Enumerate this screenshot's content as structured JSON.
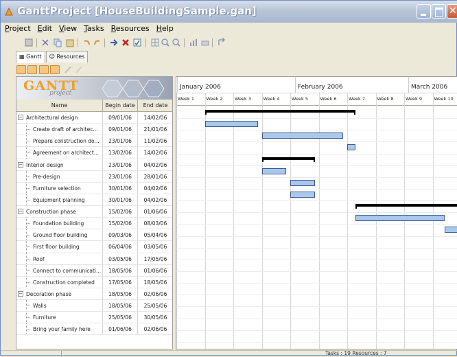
{
  "window": {
    "title": "GanttProject [HouseBuildingSample.gan]"
  },
  "menu": [
    "Project",
    "Edit",
    "View",
    "Tasks",
    "Resources",
    "Help"
  ],
  "tabs": [
    {
      "label": "Gantt",
      "active": true
    },
    {
      "label": "Resources",
      "active": false
    }
  ],
  "logo": {
    "word": "GANTT",
    "sub": "project"
  },
  "tree": {
    "columns": [
      "Name",
      "Begin date",
      "End date"
    ],
    "rows": [
      {
        "name": "Architectural design",
        "begin": "09/01/06",
        "end": "14/02/06",
        "group": true
      },
      {
        "name": "Create draft of architec...",
        "begin": "09/01/06",
        "end": "21/01/06"
      },
      {
        "name": "Prepare construction do...",
        "begin": "23/01/06",
        "end": "11/02/06"
      },
      {
        "name": "Agreement on architect...",
        "begin": "13/02/06",
        "end": "14/02/06"
      },
      {
        "name": "Interior design",
        "begin": "23/01/06",
        "end": "04/02/06",
        "group": true
      },
      {
        "name": "Pre-design",
        "begin": "23/01/06",
        "end": "28/01/06"
      },
      {
        "name": "Furniture selection",
        "begin": "30/01/06",
        "end": "04/02/06"
      },
      {
        "name": "Equipment planning",
        "begin": "30/01/06",
        "end": "04/02/06"
      },
      {
        "name": "Construction phase",
        "begin": "15/02/06",
        "end": "01/06/06",
        "group": true
      },
      {
        "name": "Foundation building",
        "begin": "15/02/06",
        "end": "08/03/06"
      },
      {
        "name": "Ground floor building",
        "begin": "09/03/06",
        "end": "05/04/06"
      },
      {
        "name": "First floor building",
        "begin": "06/04/06",
        "end": "03/05/06"
      },
      {
        "name": "Roof",
        "begin": "03/05/06",
        "end": "17/05/06"
      },
      {
        "name": "Connect to communicati...",
        "begin": "18/05/06",
        "end": "01/06/06"
      },
      {
        "name": "Construction completed",
        "begin": "17/05/06",
        "end": "18/05/06"
      },
      {
        "name": "Decoration phase",
        "begin": "18/05/06",
        "end": "02/06/06",
        "group": true
      },
      {
        "name": "Walls",
        "begin": "18/05/06",
        "end": "25/05/06"
      },
      {
        "name": "Furniture",
        "begin": "25/05/06",
        "end": "30/05/06"
      },
      {
        "name": "Bring your family here",
        "begin": "01/06/06",
        "end": "02/06/06"
      }
    ]
  },
  "chart": {
    "months": [
      "January 2006",
      "February 2006",
      "March 2006"
    ],
    "weeks": [
      "Week 1",
      "Week 2",
      "Week 3",
      "Week 4",
      "Week 5",
      "Week 6",
      "Week 7",
      "Week 8",
      "Week 9",
      "Week 10"
    ]
  },
  "status": {
    "text": "Tasks : 19 Resources : 7"
  }
}
